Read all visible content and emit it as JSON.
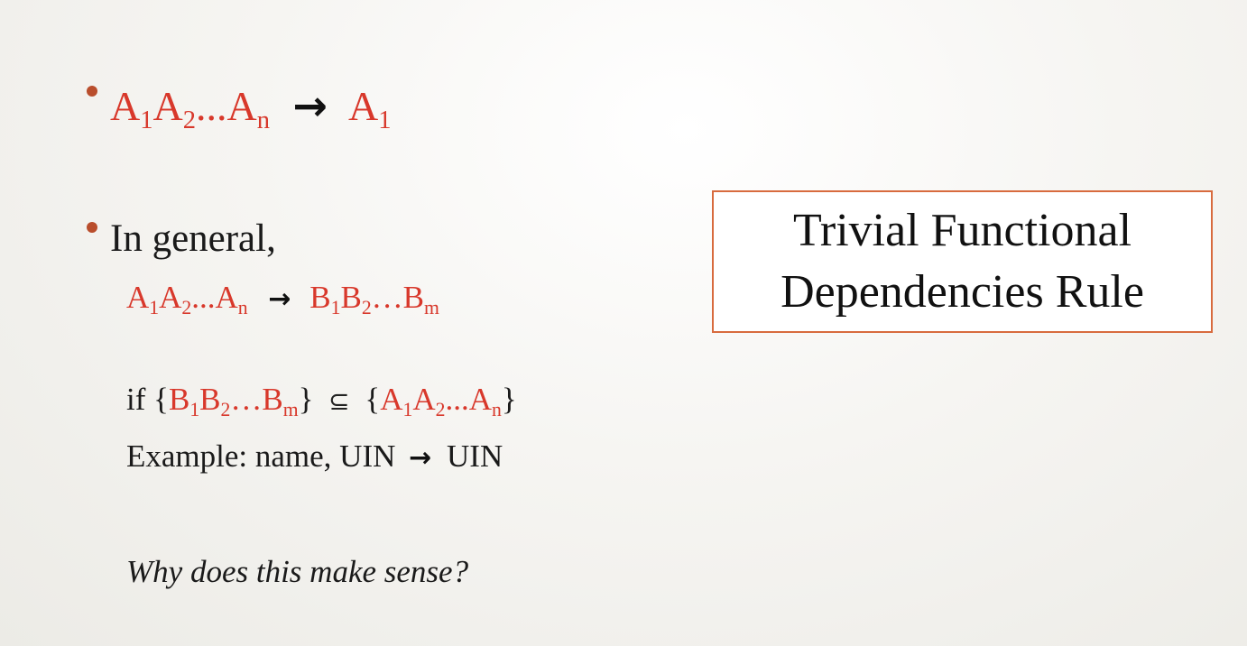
{
  "bullet1": {
    "lhs": [
      {
        "base": "A",
        "sub": "1"
      },
      {
        "base": "A",
        "sub": "2"
      },
      {
        "base": "...A",
        "sub": "n"
      }
    ],
    "arrow": "→",
    "rhs": [
      {
        "base": "A",
        "sub": "1"
      }
    ]
  },
  "bullet2": {
    "heading": "In general,",
    "rule": {
      "lhs": [
        {
          "base": "A",
          "sub": "1"
        },
        {
          "base": "A",
          "sub": "2"
        },
        {
          "base": "...A",
          "sub": "n"
        }
      ],
      "arrow": "→",
      "rhs": [
        {
          "base": "B",
          "sub": "1"
        },
        {
          "base": "B",
          "sub": "2"
        },
        {
          "base": "…B",
          "sub": "m"
        }
      ]
    },
    "condition": {
      "prefix": "if ",
      "open_brace": "{",
      "close_brace": "}",
      "subset_symbol": "⊆",
      "left_set": [
        {
          "base": "B",
          "sub": "1"
        },
        {
          "base": "B",
          "sub": "2"
        },
        {
          "base": "…B",
          "sub": "m"
        }
      ],
      "right_set": [
        {
          "base": "A",
          "sub": "1"
        },
        {
          "base": "A",
          "sub": "2"
        },
        {
          "base": "...A",
          "sub": "n"
        }
      ]
    },
    "example": {
      "lhs": "Example: name, UIN",
      "arrow": "→",
      "rhs": "UIN"
    },
    "question": "Why does this make sense?"
  },
  "rule_box": {
    "line1": "Trivial Functional",
    "line2": "Dependencies Rule"
  },
  "colors": {
    "accent_red": "#d8382b",
    "bullet": "#b94e2c",
    "box_border": "#d86b3e"
  }
}
